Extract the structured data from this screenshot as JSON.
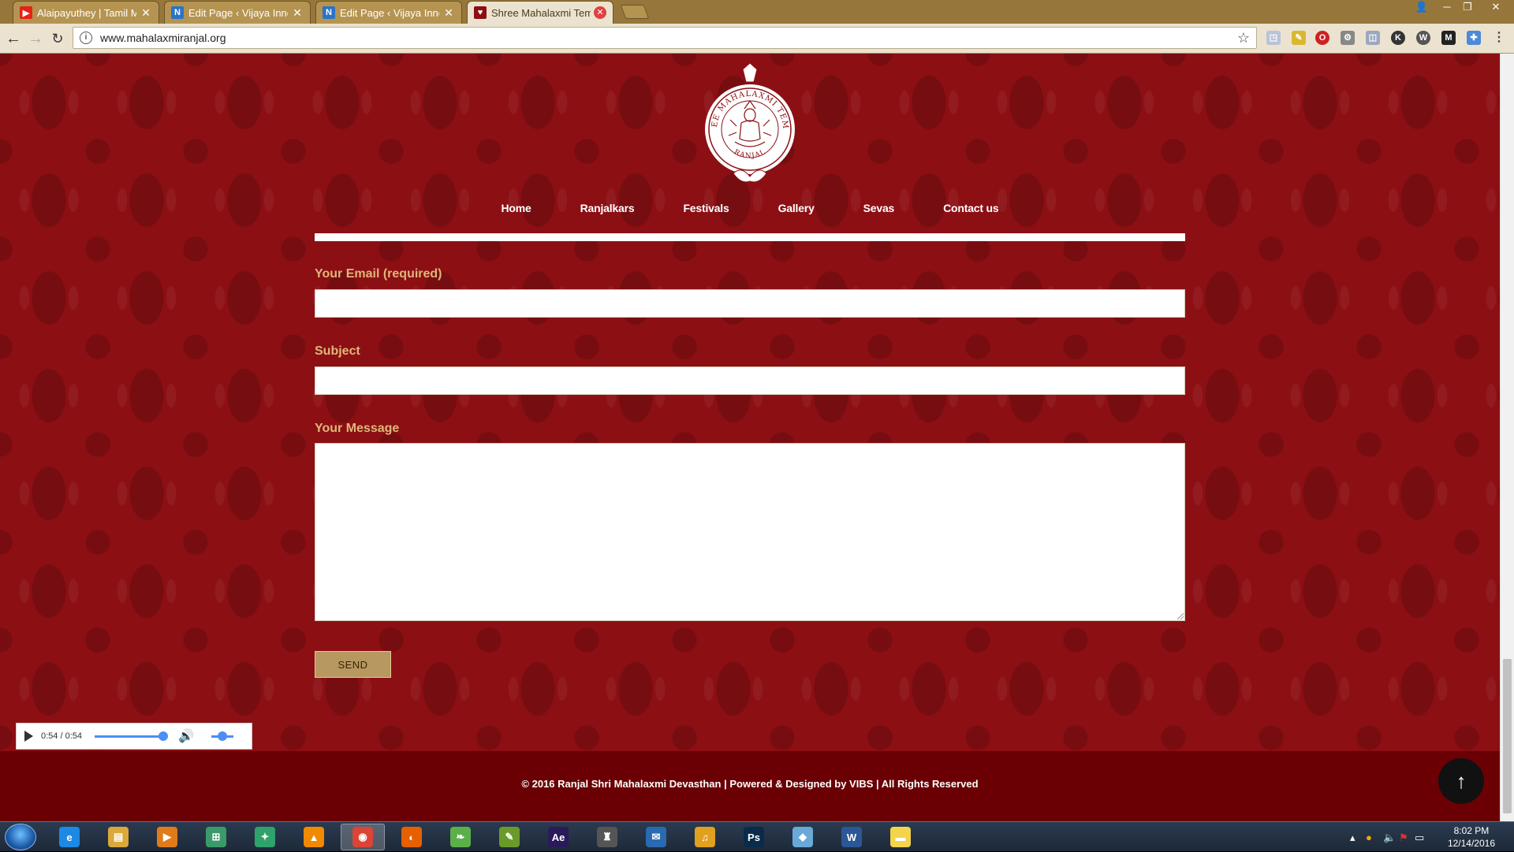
{
  "browser": {
    "tabs": [
      {
        "title": "Alaipayuthey | Tamil Mo",
        "icon": "youtube-icon",
        "color": "#e62117",
        "glyph": "▶"
      },
      {
        "title": "Edit Page ‹ Vijaya Innova",
        "icon": "wordpress-edit-icon",
        "color": "#2a74c8",
        "glyph": "N"
      },
      {
        "title": "Edit Page ‹ Vijaya Innova",
        "icon": "wordpress-edit-icon",
        "color": "#2a74c8",
        "glyph": "N"
      },
      {
        "title": "Shree Mahalaxmi Templ",
        "icon": "temple-favicon",
        "color": "#8c0f14",
        "glyph": "♥",
        "active": true
      }
    ],
    "url": "www.mahalaxmiranjal.org"
  },
  "site": {
    "logo_text_top": "SHREE MAHALAXMI TEMPLE",
    "logo_text_bottom": "RANJAL",
    "nav": [
      "Home",
      "Ranjalkars",
      "Festivals",
      "Gallery",
      "Sevas",
      "Contact us"
    ]
  },
  "form": {
    "email_label": "Your Email (required)",
    "subject_label": "Subject",
    "message_label": "Your Message",
    "send_label": "SEND"
  },
  "audio": {
    "time": "0:54 / 0:54",
    "progress": 1.0
  },
  "footer": {
    "copyright": "© 2016 Ranjal Shri Mahalaxmi Devasthan | Powered & Designed by VIBS | All Rights Reserved"
  },
  "taskbar": {
    "apps": [
      {
        "name": "internet-explorer-icon",
        "color": "#1e88e5",
        "glyph": "e"
      },
      {
        "name": "file-explorer-icon",
        "color": "#d9a93a",
        "glyph": "▤"
      },
      {
        "name": "media-player-icon",
        "color": "#e07b1a",
        "glyph": "▶"
      },
      {
        "name": "network-app-icon",
        "color": "#3a9a6a",
        "glyph": "⊞"
      },
      {
        "name": "app-green-icon",
        "color": "#2fa36b",
        "glyph": "✦"
      },
      {
        "name": "vlc-icon",
        "color": "#f08a00",
        "glyph": "▲"
      },
      {
        "name": "chrome-icon",
        "color": "#db4437",
        "glyph": "◉",
        "active": true
      },
      {
        "name": "firefox-icon",
        "color": "#e66000",
        "glyph": "◐"
      },
      {
        "name": "app-leaf-icon",
        "color": "#5bb04a",
        "glyph": "❧"
      },
      {
        "name": "notepad-app-icon",
        "color": "#6a9a2a",
        "glyph": "✎"
      },
      {
        "name": "after-effects-icon",
        "color": "#2a1a5a",
        "glyph": "Ae"
      },
      {
        "name": "inkscape-icon",
        "color": "#555555",
        "glyph": "♜"
      },
      {
        "name": "thunderbird-icon",
        "color": "#2a6ab0",
        "glyph": "✉"
      },
      {
        "name": "fl-studio-icon",
        "color": "#e0a020",
        "glyph": "♫"
      },
      {
        "name": "photoshop-icon",
        "color": "#0b2b4a",
        "glyph": "Ps"
      },
      {
        "name": "eraser-app-icon",
        "color": "#6aa8d8",
        "glyph": "◆"
      },
      {
        "name": "word-document-icon",
        "color": "#2b5797",
        "glyph": "W"
      },
      {
        "name": "sticky-notes-icon",
        "color": "#f2d54a",
        "glyph": "▬"
      }
    ],
    "clock_time": "8:02 PM",
    "clock_date": "12/14/2016"
  }
}
